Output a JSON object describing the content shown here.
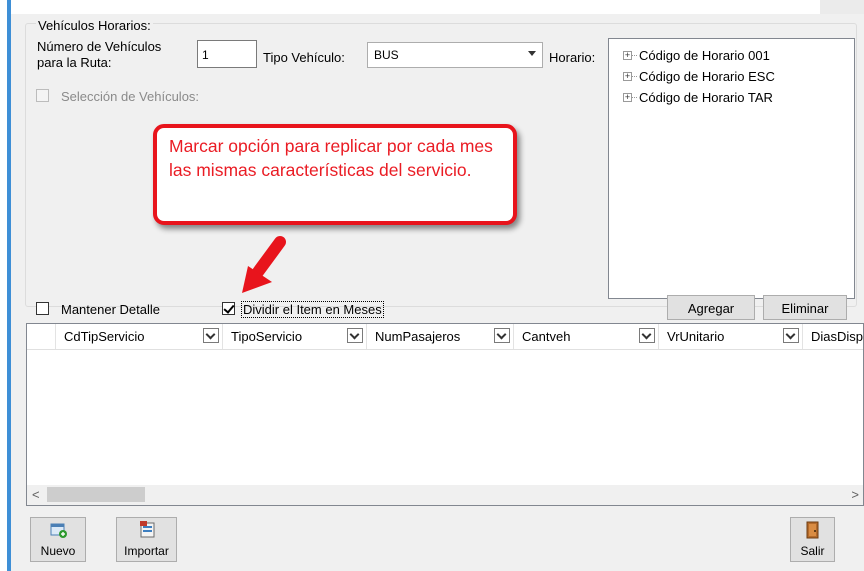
{
  "section_title": "Vehículos Horarios:",
  "num_vehiculos": {
    "label_line1": "Número de Vehículos",
    "label_line2": "para la Ruta:",
    "value": "1"
  },
  "tipo_vehiculo": {
    "label": "Tipo Vehículo:",
    "value": "BUS"
  },
  "horario": {
    "label": "Horario:",
    "nodes": [
      "Código de Horario 001",
      "Código de Horario ESC",
      "Código de Horario TAR"
    ],
    "expander": "+"
  },
  "seleccion_vehiculos": {
    "label": "Selección de Vehículos:",
    "checked": false
  },
  "callout": {
    "text": "Marcar opción para replicar por cada mes las mismas características del servicio.",
    "color": "#e8141c"
  },
  "mantener_detalle": {
    "label": "Mantener Detalle",
    "checked": false
  },
  "dividir_item": {
    "label": "Dividir el Item en Meses",
    "checked": true
  },
  "buttons": {
    "agregar": "Agregar",
    "eliminar": "Eliminar",
    "nuevo": "Nuevo",
    "importar": "Importar",
    "salir": "Salir"
  },
  "grid": {
    "columns": [
      "CdTipServicio",
      "TipoServicio",
      "NumPasajeros",
      "Cantveh",
      "VrUnitario",
      "DiasDisp"
    ],
    "scroll_left": "<",
    "scroll_right": ">"
  },
  "colors": {
    "accent": "#3e8fd6",
    "callout_border": "#e8141c",
    "arrow": "#e8141c"
  }
}
